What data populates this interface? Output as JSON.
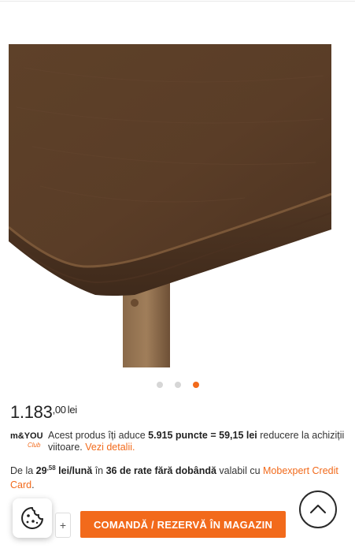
{
  "gallery": {
    "image_alt": "Masa din lemn, detaliu colt",
    "dots": 3,
    "active_dot": 3
  },
  "price": {
    "integer": "1.183",
    "decimals": ",00",
    "currency": "lei"
  },
  "loyalty": {
    "logo_text": "m&YOU",
    "logo_sub": "Club",
    "text_before": "Acest produs îți aduce ",
    "points": "5.915 puncte = 59,15 lei",
    "text_after": " reducere la achiziții viitoare. ",
    "link": "Vezi detalii."
  },
  "installments": {
    "prefix": "De la ",
    "amount_int": "29",
    "amount_dec": ",58",
    "per_month": " lei/lună",
    "in": " în ",
    "rates": "36 de rate fără dobândă",
    "suffix": " valabil cu ",
    "card_link": "Mobexpert Credit Card",
    "end": "."
  },
  "actions": {
    "plus_label": "+",
    "order_label": "COMANDĂ / REZERVĂ ÎN MAGAZIN"
  },
  "colors": {
    "accent": "#f26a1b",
    "wood": "#5a3d28"
  },
  "icons": {
    "cookie": "cookie-icon",
    "scroll_top": "chevron-up-icon"
  }
}
